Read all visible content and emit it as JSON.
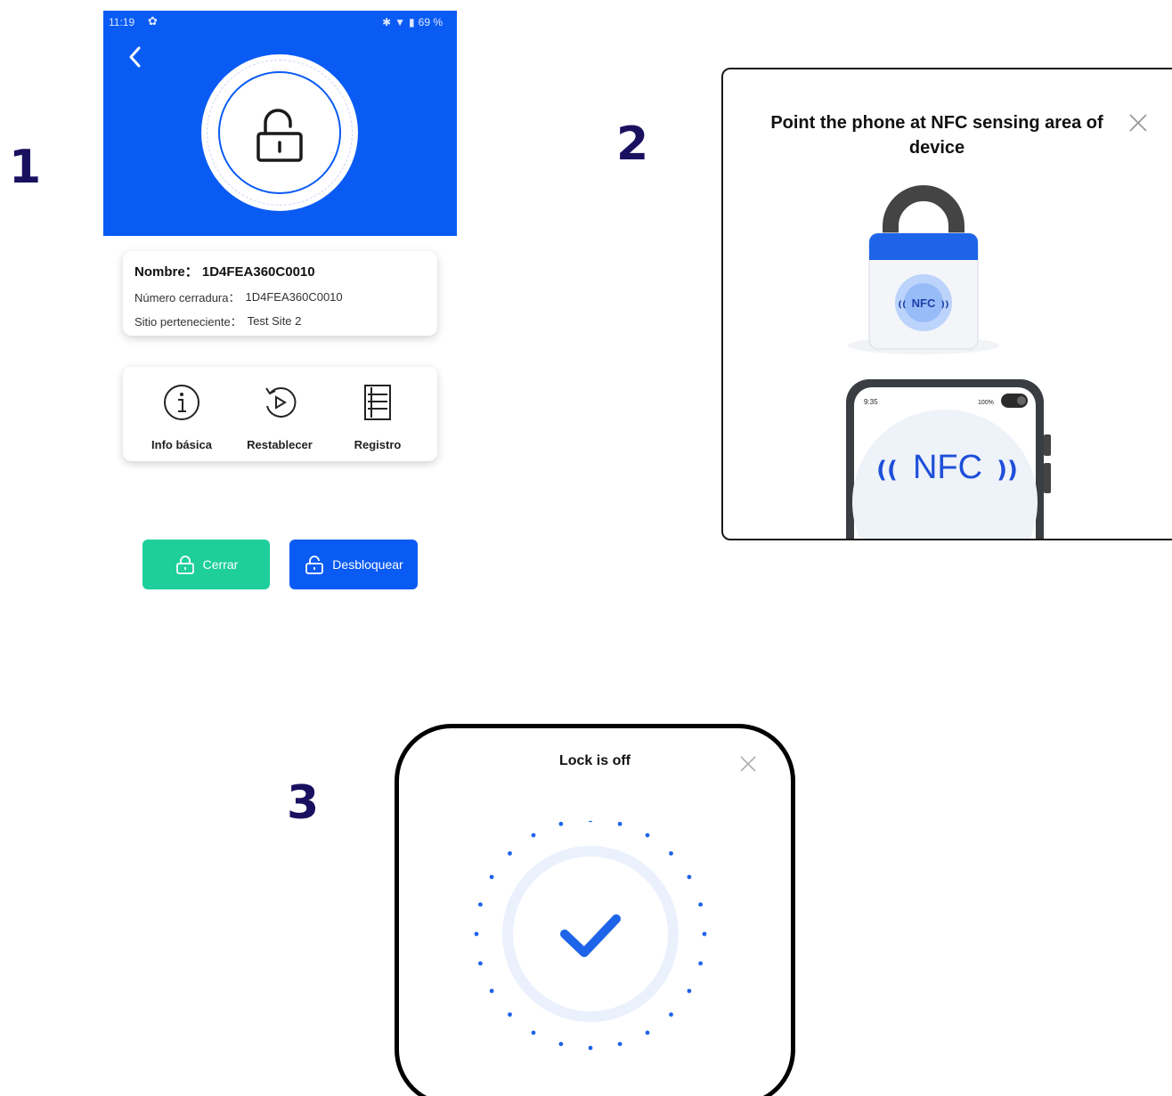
{
  "steps": {
    "one": "1",
    "two": "2",
    "three": "3"
  },
  "screen1": {
    "status": {
      "time": "11:19",
      "battery": "69 %"
    },
    "info": {
      "name_label": "Nombre：",
      "name_value": "1D4FEA360C0010",
      "lock_number_label": "Número cerradura：",
      "lock_number_value": "1D4FEA360C0010",
      "site_label": "Sitio perteneciente：",
      "site_value": "Test Site 2"
    },
    "actions": {
      "basic_info": "Info básica",
      "reset": "Restablecer",
      "record": "Registro"
    },
    "buttons": {
      "close": "Cerrar",
      "unlock": "Desbloquear"
    },
    "colors": {
      "primary": "#0a5bf4",
      "close_btn": "#1ecf9b"
    }
  },
  "screen2": {
    "title": "Point the phone at NFC sensing area of device",
    "lock_badge": "NFC",
    "phone_time": "9:35",
    "phone_battery": "100%",
    "phone_label": "NFC"
  },
  "screen3": {
    "title": "Lock is off"
  }
}
